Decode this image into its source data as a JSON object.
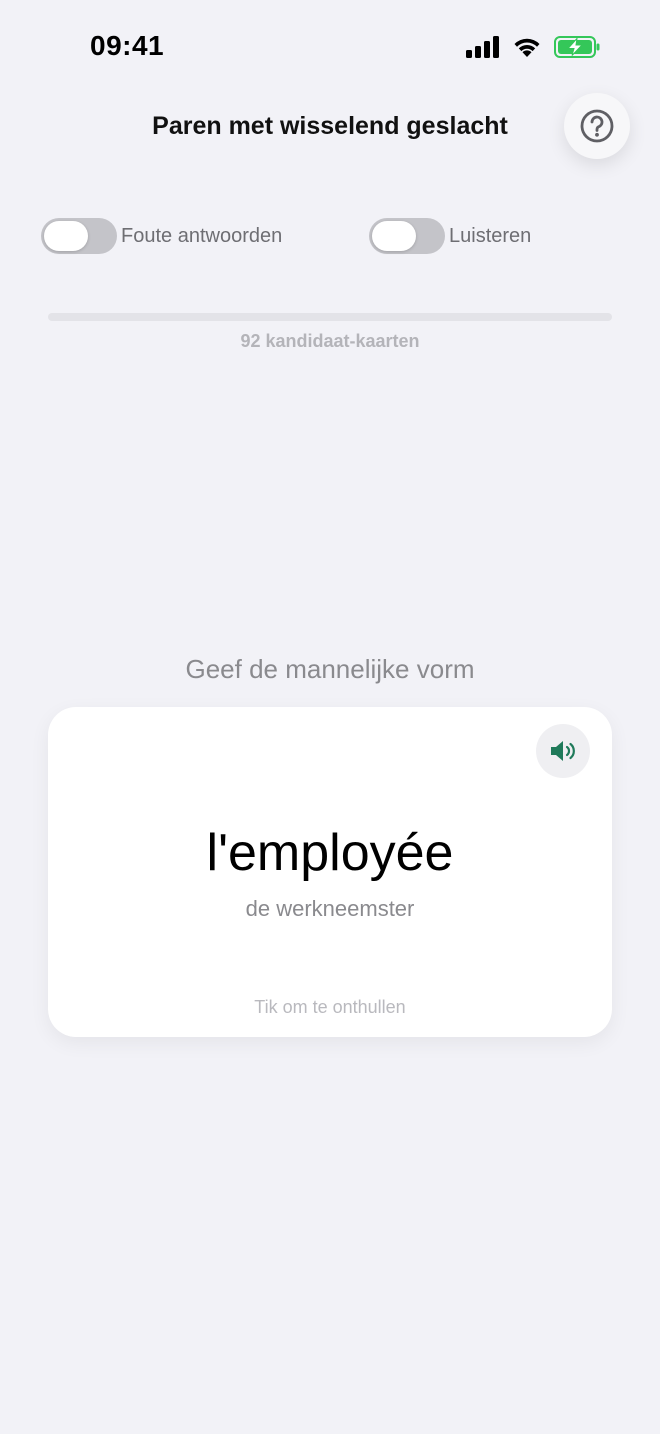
{
  "status_bar": {
    "time": "09:41",
    "icons": [
      "cellular-signal-icon",
      "wifi-icon",
      "battery-charging-icon"
    ],
    "battery_color": "#34c759"
  },
  "header": {
    "title": "Paren met wisselend geslacht",
    "help_icon": "question-mark-icon"
  },
  "toggles": [
    {
      "label": "Foute antwoorden",
      "on": false
    },
    {
      "label": "Luisteren",
      "on": false
    }
  ],
  "progress": {
    "fraction": 0,
    "caption": "92 kandidaat-kaarten"
  },
  "prompt": "Geef de mannelijke vorm",
  "card": {
    "word": "l'employée",
    "translation": "de werkneemster",
    "hint": "Tik om te onthullen",
    "speaker_icon": "speaker-icon",
    "accent_color": "#1f7a5a"
  }
}
